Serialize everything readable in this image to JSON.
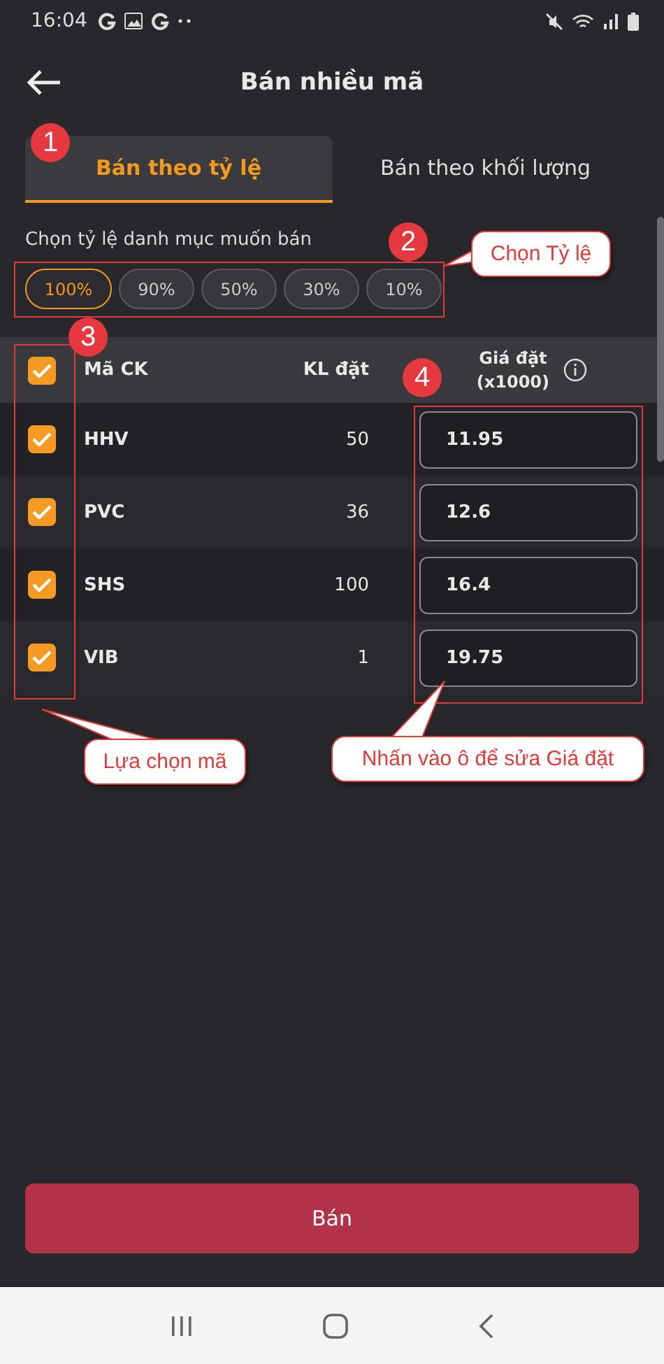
{
  "status_bar": {
    "time": "16:04"
  },
  "header": {
    "title": "Bán nhiều mã"
  },
  "tabs": [
    {
      "label": "Bán theo tỷ lệ",
      "selected": true
    },
    {
      "label": "Bán theo khối lượng",
      "selected": false
    }
  ],
  "ratio_label": "Chọn tỷ lệ danh mục muốn bán",
  "ratios": [
    {
      "label": "100%",
      "selected": true
    },
    {
      "label": "90%",
      "selected": false
    },
    {
      "label": "50%",
      "selected": false
    },
    {
      "label": "30%",
      "selected": false
    },
    {
      "label": "10%",
      "selected": false
    }
  ],
  "table": {
    "select_all_checked": true,
    "columns": [
      {
        "label": "Mã CK"
      },
      {
        "label": "KL đặt"
      },
      {
        "label": "Giá đặt",
        "sublabel": "(x1000)"
      }
    ],
    "rows": [
      {
        "checked": true,
        "symbol": "HHV",
        "quantity": "50",
        "price": "11.95"
      },
      {
        "checked": true,
        "symbol": "PVC",
        "quantity": "36",
        "price": "12.6"
      },
      {
        "checked": true,
        "symbol": "SHS",
        "quantity": "100",
        "price": "16.4"
      },
      {
        "checked": true,
        "symbol": "VIB",
        "quantity": "1",
        "price": "19.75"
      }
    ]
  },
  "annotations": {
    "badges": [
      "1",
      "2",
      "3",
      "4"
    ],
    "callouts": [
      "Chọn Tỷ lệ",
      "Lựa chọn mã",
      "Nhấn vào ô để sửa Giá đặt"
    ]
  },
  "submit_button": {
    "label": "Bán"
  }
}
